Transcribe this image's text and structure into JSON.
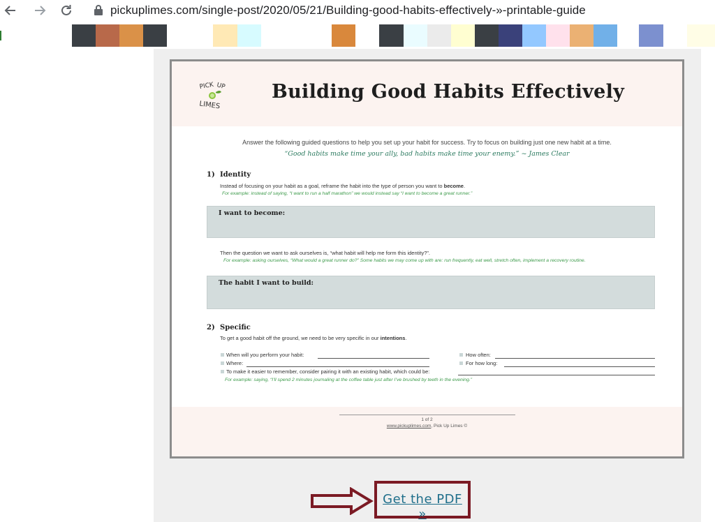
{
  "browser": {
    "url": "pickuplimes.com/single-post/2020/05/21/Building-good-habits-effectively-»-printable-guide"
  },
  "icons": {
    "back": "arrow-left-icon",
    "forward": "arrow-right-icon",
    "reload": "reload-icon",
    "lock": "lock-icon"
  },
  "swatches": [
    "#3a3f44",
    "#b8694a",
    "#da9148",
    "#3a3f44",
    "#ffffff",
    "#ffe9b5",
    "#d7fbff",
    "#ffffff",
    "#d9883c",
    "#ffffff",
    "#3a3f44",
    "#eafcff",
    "#ebebeb",
    "#fffed1",
    "#3a3f44",
    "#3a417a",
    "#93c8ff",
    "#ffe1ec",
    "#ebb173",
    "#71b0e8",
    "#ffffff",
    "#7c90cf",
    "#ffffff",
    "#fffde6"
  ],
  "doc": {
    "logo_line1": "PICK UP",
    "logo_line2": "LIMES",
    "title": "Building Good Habits Effectively",
    "intro": "Answer the following guided questions to help you set up your habit for success. Try to focus on building just one new habit at a time.",
    "quote": "“Good habits make time your ally, bad habits make time your enemy.” ~ James Clear",
    "section1": {
      "number": "1)",
      "title": "Identity",
      "text_pre": "Instead of focusing on your habit as a goal, reframe the habit into the type of person you want to ",
      "text_bold": "become",
      "text_post": ".",
      "example": "For example: instead of saying, “I want to run a half marathon” we would instead say “I want to become a great runner.”",
      "box1_label": "I want to become:",
      "text2": "Then the question we want to ask ourselves is, “what habit will help me form this identity?”.",
      "example2": "For example: asking ourselves, “What would a great runner do?” Some habits we may come up with are: run frequently, eat well, stretch often, implement a recovery routine.",
      "box2_label": "The habit I want to build:"
    },
    "section2": {
      "number": "2)",
      "title": "Specific",
      "text_pre": "To get a good habit off the ground, we need to be very specific in our ",
      "text_bold": "intentions",
      "text_post": ".",
      "field_when": "When will you perform your habit:",
      "field_where": "Where:",
      "field_pair": "To make it easier to remember, consider pairing it with an existing habit, which could be:",
      "field_often": "How often:",
      "field_long": "For how long:",
      "example": "For example: saying, “I’ll spend 2 minutes journaling at the coffee table just after I’ve brushed by teeth in the evening.”"
    },
    "footer": {
      "page": "1 of 2",
      "site": "www.pickuplimes.com",
      "brand": ", Pick Up Limes ©"
    }
  },
  "cta": {
    "label": "Get the PDF »"
  },
  "colors": {
    "accent_border": "#7b1a24",
    "link": "#1f6f8b",
    "example_green": "#3c9a4a",
    "header_bg": "#fcf3f0",
    "box_bg": "#d3dcdc"
  }
}
